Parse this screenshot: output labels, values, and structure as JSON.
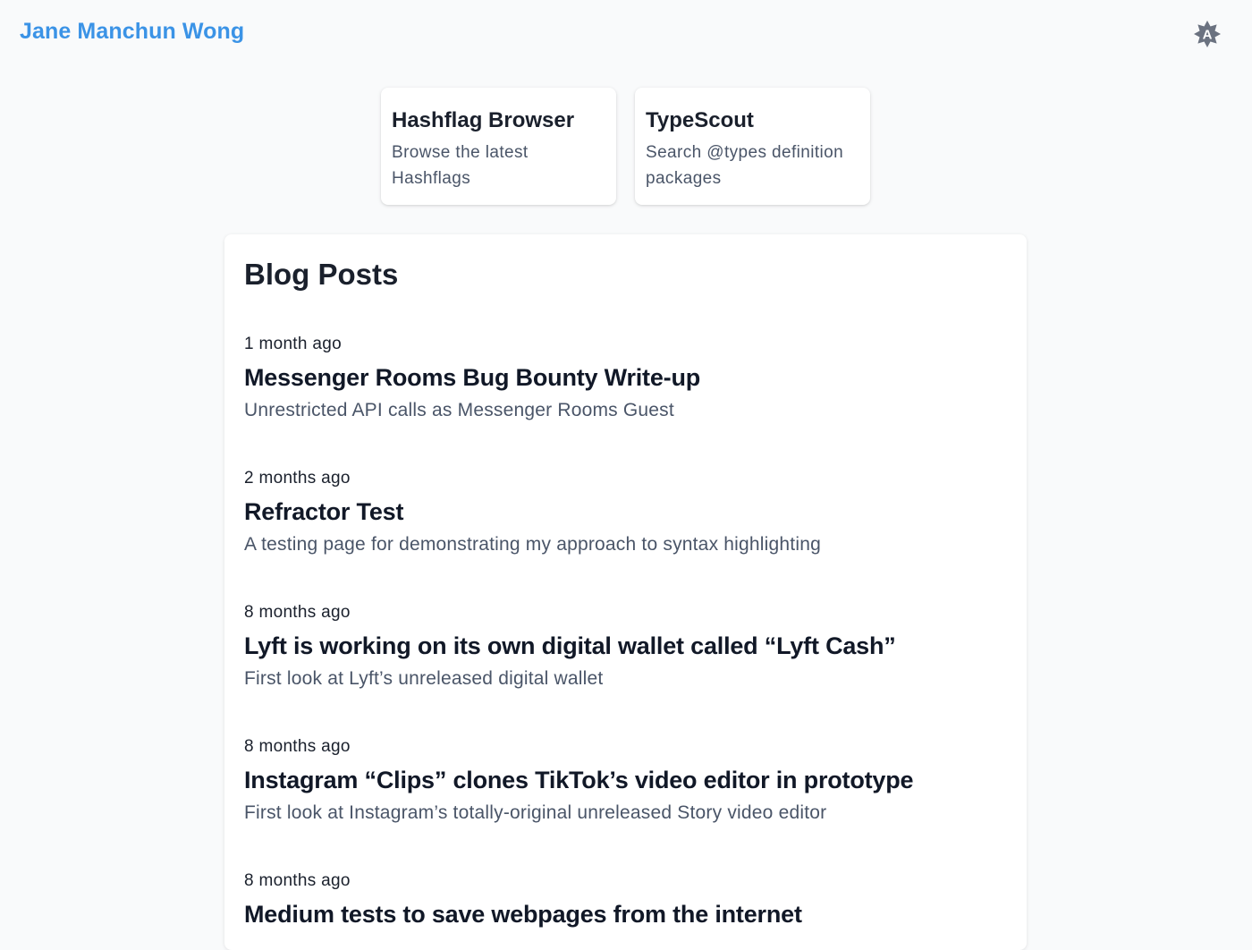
{
  "header": {
    "site_title": "Jane Manchun Wong",
    "theme_toggle_icon": "theme-toggle-icon",
    "theme_toggle_letter": "A"
  },
  "projects": [
    {
      "title": "Hashflag Browser",
      "description": "Browse the latest Hashflags"
    },
    {
      "title": "TypeScout",
      "description": "Search @types definition packages"
    }
  ],
  "blog": {
    "heading": "Blog Posts",
    "posts": [
      {
        "date": "1 month ago",
        "title": "Messenger Rooms Bug Bounty Write-up",
        "description": "Unrestricted API calls as Messenger Rooms Guest"
      },
      {
        "date": "2 months ago",
        "title": "Refractor Test",
        "description": "A testing page for demonstrating my approach to syntax highlighting"
      },
      {
        "date": "8 months ago",
        "title": "Lyft is working on its own digital wallet called “Lyft Cash”",
        "description": "First look at Lyft’s unreleased digital wallet"
      },
      {
        "date": "8 months ago",
        "title": "Instagram “Clips” clones TikTok’s video editor in prototype",
        "description": "First look at Instagram’s totally-original unreleased Story video editor"
      },
      {
        "date": "8 months ago",
        "title": "Medium tests to save webpages from the internet",
        "description": ""
      }
    ]
  },
  "colors": {
    "accent": "#3b93e6",
    "background": "#f9fafb",
    "card": "#ffffff",
    "text": "#1a202c",
    "muted": "#4a5568",
    "icon": "#6b7280"
  }
}
